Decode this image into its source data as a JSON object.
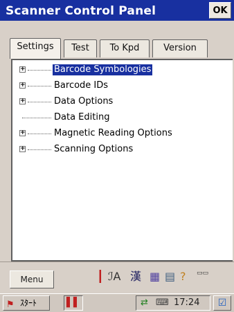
{
  "window": {
    "title": "Scanner Control Panel",
    "ok_label": "OK"
  },
  "tabs": [
    {
      "label": "Settings",
      "active": true
    },
    {
      "label": "Test",
      "active": false
    },
    {
      "label": "To Kpd",
      "active": false
    },
    {
      "label": "Version",
      "active": false
    }
  ],
  "tree": {
    "items": [
      {
        "label": "Barcode Symbologies",
        "expandable": true,
        "selected": true
      },
      {
        "label": "Barcode IDs",
        "expandable": true,
        "selected": false
      },
      {
        "label": "Data Options",
        "expandable": true,
        "selected": false
      },
      {
        "label": "Data Editing",
        "expandable": false,
        "selected": false
      },
      {
        "label": "Magnetic Reading Options",
        "expandable": true,
        "selected": false
      },
      {
        "label": "Scanning Options",
        "expandable": true,
        "selected": false
      }
    ]
  },
  "bottombar": {
    "menu_label": "Menu",
    "sip_icons": [
      "input-marker-icon",
      "font-a-icon",
      "kanji-icon",
      "notebook-icon",
      "grid-icon",
      "help-icon",
      "card-icon"
    ]
  },
  "taskbar": {
    "start_label": "ｽﾀｰﾄ",
    "task_icon": "scanner-app-icon",
    "clock": "17:24"
  },
  "colors": {
    "accent": "#1830a0",
    "background": "#d8d0c8"
  }
}
